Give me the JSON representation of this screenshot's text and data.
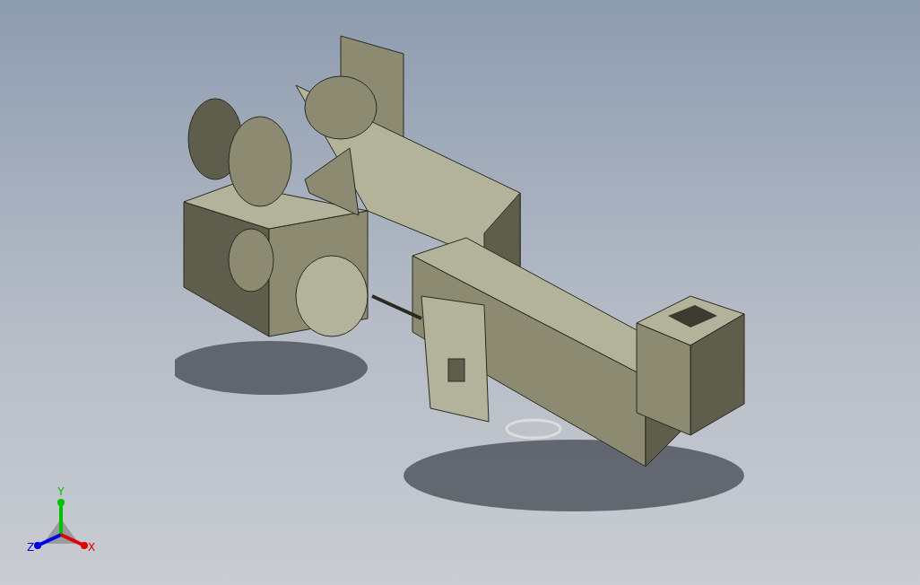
{
  "viewport": {
    "triad": {
      "axes": [
        {
          "label": "Y",
          "color": "#00c000"
        },
        {
          "label": "Z",
          "color": "#0000e0"
        },
        {
          "label": "X",
          "color": "#e00000"
        }
      ]
    }
  }
}
